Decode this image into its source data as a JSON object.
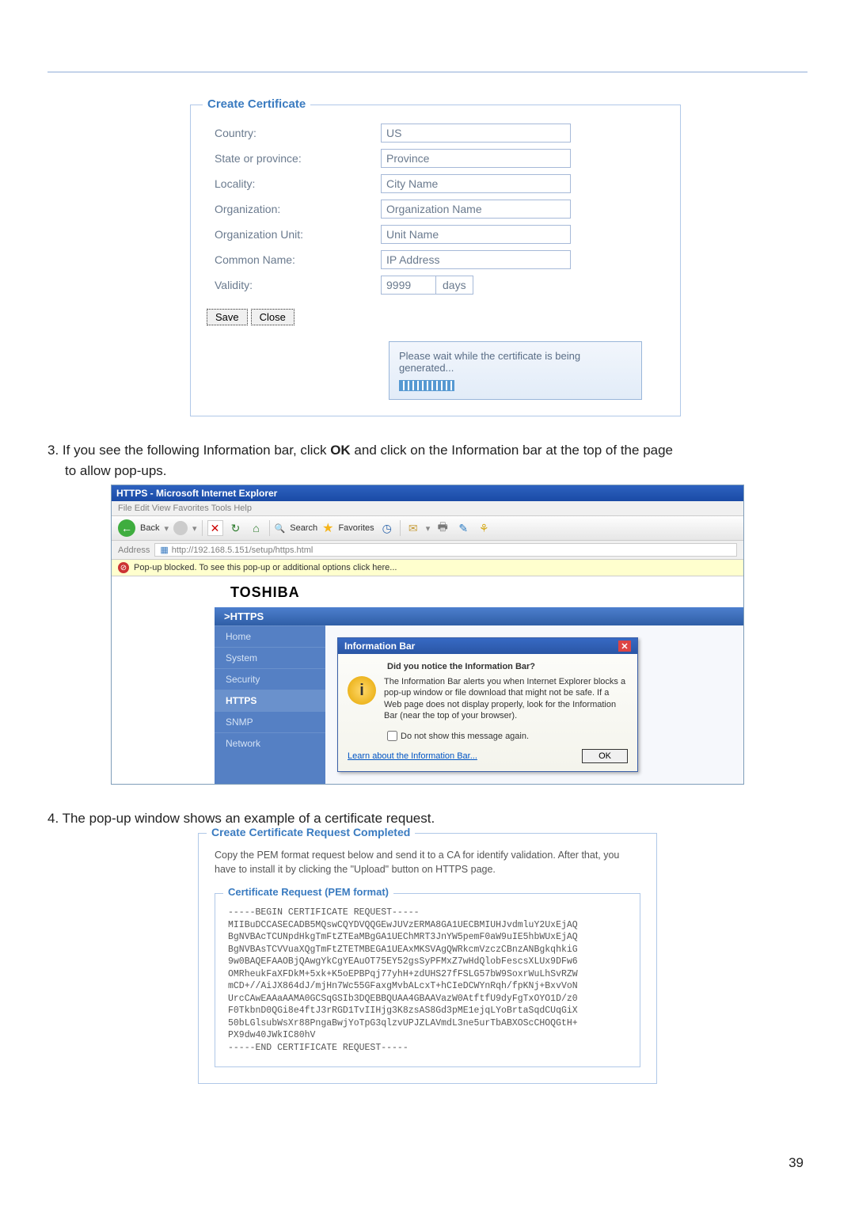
{
  "cert_form": {
    "legend": "Create Certificate",
    "country_label": "Country:",
    "country_value": "US",
    "state_label": "State or province:",
    "state_value": "Province",
    "locality_label": "Locality:",
    "locality_value": "City Name",
    "org_label": "Organization:",
    "org_value": "Organization Name",
    "orgunit_label": "Organization Unit:",
    "orgunit_value": "Unit Name",
    "cn_label": "Common Name:",
    "cn_value": "IP Address",
    "validity_label": "Validity:",
    "validity_value": "9999",
    "days_label": "days",
    "save_btn": "Save",
    "close_btn": "Close",
    "status_text": "Please wait while the certificate is being generated..."
  },
  "step3": {
    "text_before_ok": "3. If you see the following Information bar, click ",
    "ok": "OK",
    "text_after_ok": " and click on the Information bar at the top of the page",
    "line2": "to allow pop-ups."
  },
  "ie": {
    "title": "HTTPS - Microsoft Internet Explorer",
    "menu": "File   Edit   View   Favorites   Tools   Help",
    "back_label": "Back",
    "search_label": "Search",
    "fav_label": "Favorites",
    "address_label": "Address",
    "url": "http://192.168.5.151/setup/https.html",
    "infobar_text": "Pop-up blocked. To see this pop-up or additional options click here...",
    "brand": "TOSHIBA",
    "https_header": ">HTTPS",
    "sidebar": {
      "home": "Home",
      "system": "System",
      "security": "Security",
      "https": "HTTPS",
      "snmp": "SNMP",
      "network": "Network"
    },
    "dialog": {
      "title": "Information Bar",
      "heading": "Did you notice the Information Bar?",
      "body": "The Information Bar alerts you when Internet Explorer blocks a pop-up window or file download that might not be safe. If a Web page does not display properly, look for the Information Bar (near the top of your browser).",
      "checkbox": "Do not show this message again.",
      "learn": "Learn about the Information Bar...",
      "ok": "OK"
    }
  },
  "step4": "4. The pop-up window shows an example of a certificate request.",
  "cert_req": {
    "legend": "Create Certificate Request Completed",
    "desc": "Copy the PEM format request below and send it to a CA for identify validation. After that, you have to install it by clicking the \"Upload\" button on HTTPS page.",
    "pem_legend": "Certificate Request (PEM format)",
    "pem": "-----BEGIN CERTIFICATE REQUEST-----\nMIIBuDCCASECADB5MQswCQYDVQQGEwJUVzERMA8GA1UECBMIUHJvdmluY2UxEjAQ\nBgNVBAcTCUNpdHkgTmFtZTEaMBgGA1UEChMRT3JnYW5pemF0aW9uIE5hbWUxEjAQ\nBgNVBAsTCVVuaXQgTmFtZTETMBEGA1UEAxMKSVAgQWRkcmVzczCBnzANBgkqhkiG\n9w0BAQEFAAOBjQAwgYkCgYEAuOT75EY52gsSyPFMxZ7wHdQlobFescsXLUx9DFw6\nOMRheukFaXFDkM+5xk+K5oEPBPqj77yhH+zdUHS27fFSLG57bW9SoxrWuLhSvRZW\nmCD+//AiJX864dJ/mjHn7Wc55GFaxgMvbALcxT+hCIeDCWYnRqh/fpKNj+BxvVoN\nUrcCAwEAAaAAMA0GCSqGSIb3DQEBBQUAA4GBAAVazW0AtftfU9dyFgTxOYO1D/z0\nF0TkbnD0QGi8e4ftJ3rRGD1TvIIHjg3K8zsAS8Gd3pME1ejqLYoBrtaSqdCUqGiX\n50bLGlsubWsXr88PngaBwjYoTpG3qlzvUPJZLAVmdL3ne5urTbABXOScCHOQGtH+\nPX9dw40JWkIC80hV\n-----END CERTIFICATE REQUEST-----"
  },
  "page_number": "39"
}
